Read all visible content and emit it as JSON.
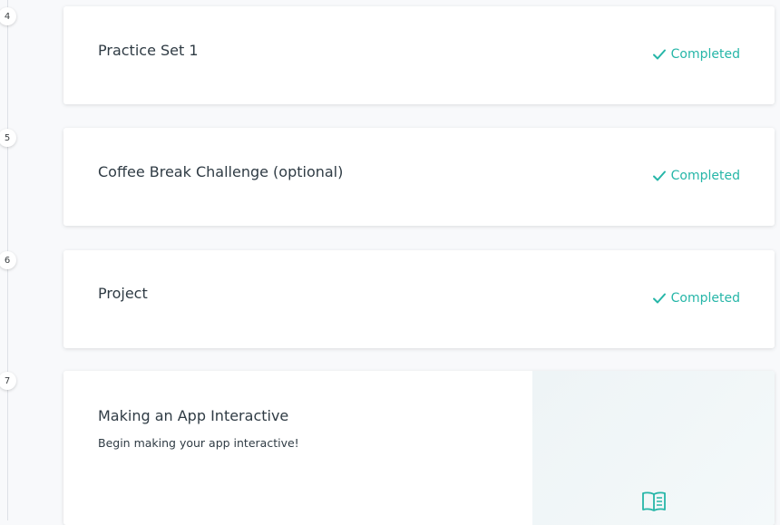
{
  "steps": [
    {
      "number": "4",
      "title": "Practice Set 1",
      "status": "Completed"
    },
    {
      "number": "5",
      "title": "Coffee Break Challenge (optional)",
      "status": "Completed"
    },
    {
      "number": "6",
      "title": "Project",
      "status": "Completed"
    },
    {
      "number": "7",
      "title": "Making an App Interactive",
      "description": "Begin making your app interactive!",
      "icon": "book-icon"
    }
  ],
  "colors": {
    "accent": "#26b6a8",
    "card_bg": "#ffffff",
    "page_bg": "#f8f9fb",
    "text": "#2f3b44"
  }
}
